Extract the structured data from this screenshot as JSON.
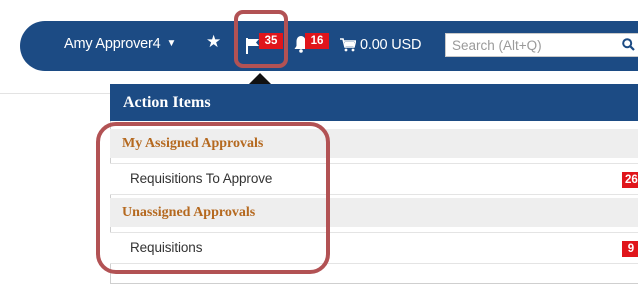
{
  "colors": {
    "navbar": "#1c4b84",
    "badge": "#e0151b",
    "section_title": "#b5691f",
    "highlight": "#b25254"
  },
  "header": {
    "user_name": "Amy Approver4",
    "user_caret": "▼",
    "favorites_icon": "star-icon",
    "action_items_icon": "flag-icon",
    "action_items_count": "35",
    "notifications_icon": "bell-icon",
    "notifications_count": "16",
    "cart_icon": "cart-icon",
    "cart_total": "0.00 USD",
    "search_placeholder": "Search (Alt+Q)",
    "search_icon": "search-icon"
  },
  "action_items": {
    "title": "Action Items",
    "sections": [
      {
        "title": "My Assigned Approvals",
        "items": [
          {
            "label": "Requisitions To Approve",
            "count": "26"
          }
        ]
      },
      {
        "title": "Unassigned Approvals",
        "items": [
          {
            "label": "Requisitions",
            "count": "9"
          }
        ]
      }
    ]
  }
}
